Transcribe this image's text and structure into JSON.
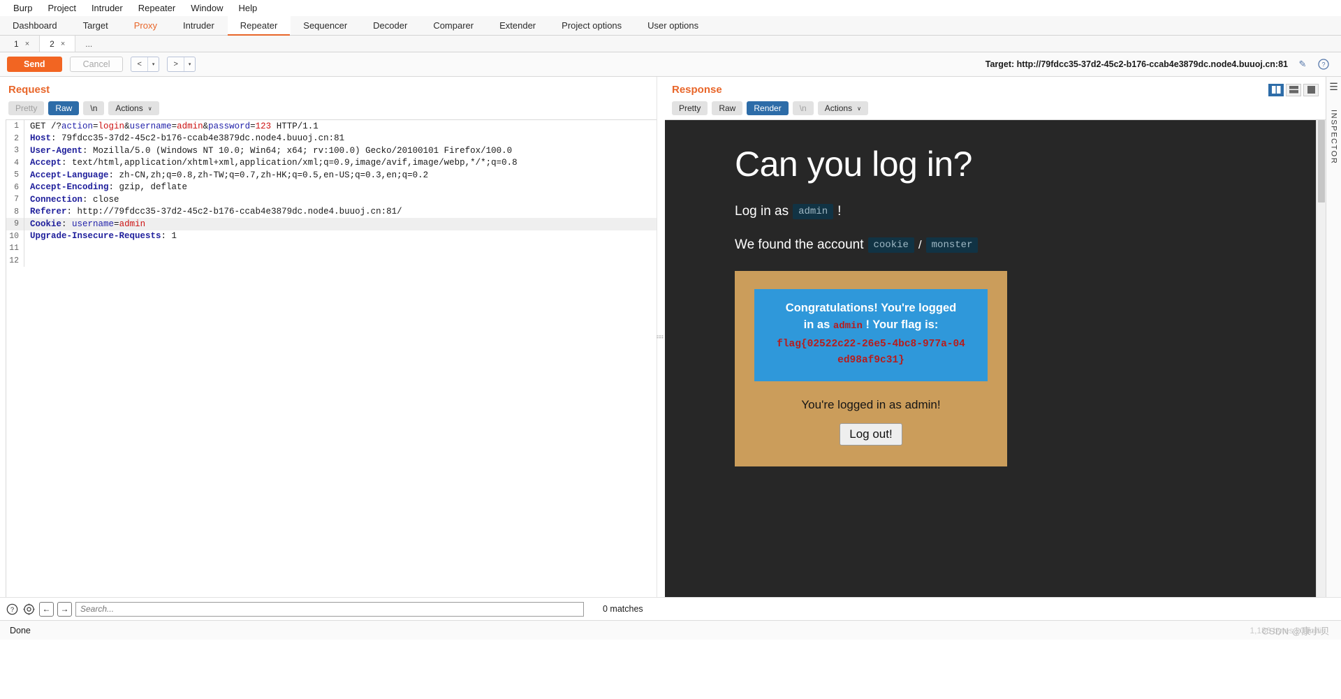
{
  "menu": {
    "items": [
      {
        "label": "Burp"
      },
      {
        "label": "Project"
      },
      {
        "label": "Intruder"
      },
      {
        "label": "Repeater"
      },
      {
        "label": "Window"
      },
      {
        "label": "Help"
      }
    ]
  },
  "main_tabs": [
    {
      "label": "Dashboard",
      "state": "normal"
    },
    {
      "label": "Target",
      "state": "normal"
    },
    {
      "label": "Proxy",
      "state": "highlight"
    },
    {
      "label": "Intruder",
      "state": "normal"
    },
    {
      "label": "Repeater",
      "state": "active"
    },
    {
      "label": "Sequencer",
      "state": "normal"
    },
    {
      "label": "Decoder",
      "state": "normal"
    },
    {
      "label": "Comparer",
      "state": "normal"
    },
    {
      "label": "Extender",
      "state": "normal"
    },
    {
      "label": "Project options",
      "state": "normal"
    },
    {
      "label": "User options",
      "state": "normal"
    }
  ],
  "sub_tabs": [
    {
      "label": "1",
      "close": "×",
      "active": false
    },
    {
      "label": "2",
      "close": "×",
      "active": true
    }
  ],
  "sub_tabs_more": "...",
  "toolbar": {
    "send_label": "Send",
    "cancel_label": "Cancel",
    "back_arrow": "<",
    "forward_arrow": ">",
    "caret": "▾",
    "target_label": "Target: http://79fdcc35-37d2-45c2-b176-ccab4e3879dc.node4.buuoj.cn:81",
    "edit_icon": "✎",
    "help_icon": "?"
  },
  "request": {
    "title": "Request",
    "format_buttons": [
      {
        "label": "Pretty",
        "state": "muted"
      },
      {
        "label": "Raw",
        "state": "active"
      },
      {
        "label": "\\n",
        "state": "normal"
      }
    ],
    "actions_label": "Actions",
    "actions_caret": "∨",
    "lines": [
      {
        "n": "1",
        "parts": [
          {
            "t": "GET /?",
            "c": "k-plain"
          },
          {
            "t": "action",
            "c": "k-par"
          },
          {
            "t": "=",
            "c": "k-plain"
          },
          {
            "t": "login",
            "c": "k-val"
          },
          {
            "t": "&",
            "c": "k-plain"
          },
          {
            "t": "username",
            "c": "k-par"
          },
          {
            "t": "=",
            "c": "k-plain"
          },
          {
            "t": "admin",
            "c": "k-val"
          },
          {
            "t": "&",
            "c": "k-plain"
          },
          {
            "t": "password",
            "c": "k-par"
          },
          {
            "t": "=",
            "c": "k-plain"
          },
          {
            "t": "123",
            "c": "k-val"
          },
          {
            "t": " HTTP/1.1",
            "c": "k-plain"
          }
        ]
      },
      {
        "n": "2",
        "parts": [
          {
            "t": "Host",
            "c": "k-hdr"
          },
          {
            "t": ": 79fdcc35-37d2-45c2-b176-ccab4e3879dc.node4.buuoj.cn:81",
            "c": "k-plain"
          }
        ]
      },
      {
        "n": "3",
        "parts": [
          {
            "t": "User-Agent",
            "c": "k-hdr"
          },
          {
            "t": ": Mozilla/5.0 (Windows NT 10.0; Win64; x64; rv:100.0) Gecko/20100101 Firefox/100.0",
            "c": "k-plain"
          }
        ]
      },
      {
        "n": "4",
        "parts": [
          {
            "t": "Accept",
            "c": "k-hdr"
          },
          {
            "t": ": text/html,application/xhtml+xml,application/xml;q=0.9,image/avif,image/webp,*/*;q=0.8",
            "c": "k-plain"
          }
        ]
      },
      {
        "n": "5",
        "parts": [
          {
            "t": "Accept-Language",
            "c": "k-hdr"
          },
          {
            "t": ": zh-CN,zh;q=0.8,zh-TW;q=0.7,zh-HK;q=0.5,en-US;q=0.3,en;q=0.2",
            "c": "k-plain"
          }
        ]
      },
      {
        "n": "6",
        "parts": [
          {
            "t": "Accept-Encoding",
            "c": "k-hdr"
          },
          {
            "t": ": gzip, deflate",
            "c": "k-plain"
          }
        ]
      },
      {
        "n": "7",
        "parts": [
          {
            "t": "Connection",
            "c": "k-hdr"
          },
          {
            "t": ": close",
            "c": "k-plain"
          }
        ]
      },
      {
        "n": "8",
        "parts": [
          {
            "t": "Referer",
            "c": "k-hdr"
          },
          {
            "t": ": http://79fdcc35-37d2-45c2-b176-ccab4e3879dc.node4.buuoj.cn:81/",
            "c": "k-plain"
          }
        ]
      },
      {
        "n": "9",
        "highlight": true,
        "parts": [
          {
            "t": "Cookie",
            "c": "k-hdr"
          },
          {
            "t": ": ",
            "c": "k-plain"
          },
          {
            "t": "username",
            "c": "k-par"
          },
          {
            "t": "=",
            "c": "k-plain"
          },
          {
            "t": "admin",
            "c": "k-val"
          }
        ]
      },
      {
        "n": "10",
        "parts": [
          {
            "t": "Upgrade-Insecure-Requests",
            "c": "k-hdr"
          },
          {
            "t": ": 1",
            "c": "k-plain"
          }
        ]
      },
      {
        "n": "11",
        "parts": []
      },
      {
        "n": "12",
        "parts": []
      }
    ]
  },
  "response": {
    "title": "Response",
    "format_buttons": [
      {
        "label": "Pretty",
        "state": "normal"
      },
      {
        "label": "Raw",
        "state": "normal"
      },
      {
        "label": "Render",
        "state": "active"
      },
      {
        "label": "\\n",
        "state": "muted"
      }
    ],
    "actions_label": "Actions",
    "actions_caret": "∨",
    "render": {
      "heading": "Can you log in?",
      "login_prefix": "Log in as",
      "login_user": "admin",
      "login_suffix": "!",
      "found_prefix": "We found the account",
      "found_user": "cookie",
      "found_sep": "/",
      "found_pass": "monster",
      "alert_line1": "Congratulations! You're logged",
      "alert_line2_a": "in as",
      "alert_user": "admin",
      "alert_line2_b": "! Your flag is:",
      "flag": "flag{02522c22-26e5-4bc8-977a-04ed98af9c31}",
      "status_text": "You're logged in as admin!",
      "logout_label": "Log out!"
    }
  },
  "inspector": {
    "label": "INSPECTOR",
    "menu_icon": "☰"
  },
  "search": {
    "placeholder": "Search...",
    "value": "",
    "matches": "0 matches",
    "help_icon": "?",
    "settings_icon": "⚙",
    "prev_icon": "←",
    "next_icon": "→"
  },
  "statusbar": {
    "status": "Done",
    "byte_info": "1,186 bytes | 0 millis",
    "watermark": "CSDN @康小贝"
  },
  "colors": {
    "accent": "#f26522",
    "tab_active": "#2d6ca8",
    "render_bg": "#272727",
    "card_bg": "#cb9d5b",
    "alert_bg": "#2f98da",
    "flag_red": "#b71c1c"
  }
}
